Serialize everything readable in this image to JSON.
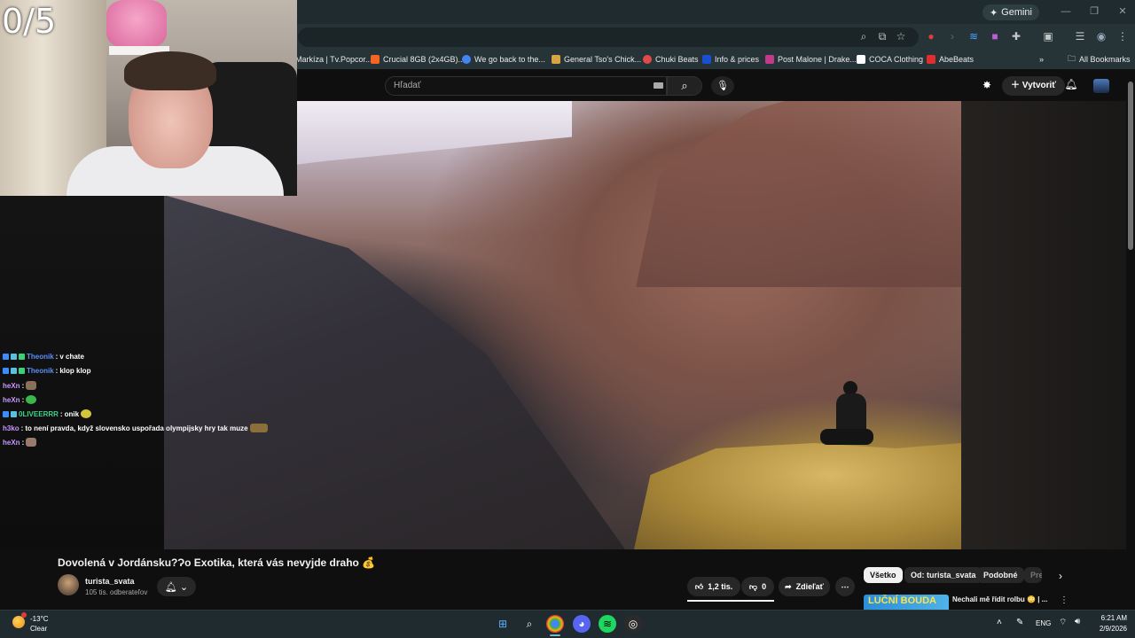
{
  "browser": {
    "gemini_label": "Gemini",
    "bookmarks": [
      {
        "label": "Markíza | Tv.Popcor...",
        "color": "#e8eaed"
      },
      {
        "label": "Crucial 8GB (2x4GB)...",
        "color": "#f26522"
      },
      {
        "label": "We go back to the...",
        "color": "#4285f4"
      },
      {
        "label": "General Tso's Chick...",
        "color": "#d9a441"
      },
      {
        "label": "Chuki Beats",
        "color": "#e24a4a"
      },
      {
        "label": "Info & prices",
        "color": "#1a4fd1"
      },
      {
        "label": "Post Malone | Drake...",
        "color": "#c23a8a"
      },
      {
        "label": "COCA Clothing",
        "color": "#111111"
      },
      {
        "label": "AbeBeats",
        "color": "#e02d2d"
      }
    ],
    "all_bookmarks_label": "All Bookmarks"
  },
  "youtube": {
    "search_placeholder": "Hľadať",
    "create_label": "Vytvoriť",
    "video_title": "Dovolená v Jordánsku?Ɂo Exotika, která vás nevyjde draho 💰",
    "channel_name": "turista_svata",
    "subscribers": "105 tis. odberateľov",
    "likes": "1,2 tis.",
    "dislikes": "0",
    "share_label": "Zdieľať",
    "chips": [
      "Všetko",
      "Od: turista_svata",
      "Podobné",
      "Pre"
    ],
    "recommended_thumb_text": "LUČNÍ BOUDA",
    "recommended_title": "Nechali mě řídit rolbu 😳 | ..."
  },
  "stream": {
    "counter": "0/5",
    "chat": [
      {
        "user": "Theonik",
        "user_color": "#5b8ff9",
        "message": "v chate",
        "badges": [
          "#3d8bff",
          "#5bc0de",
          "#3bd17a"
        ]
      },
      {
        "user": "Theonik",
        "user_color": "#5b8ff9",
        "message": "klop klop",
        "badges": [
          "#3d8bff",
          "#5bc0de",
          "#3bd17a"
        ]
      },
      {
        "user": "heXn",
        "user_color": "#c996ff",
        "message": "",
        "emote": "#8a6f5a",
        "badges": []
      },
      {
        "user": "heXn",
        "user_color": "#c996ff",
        "message": "",
        "emote": "#3bb64a",
        "badges": []
      },
      {
        "user": "0LIVEERRR",
        "user_color": "#3fd08c",
        "message": "onik",
        "emote": "#d4c43a",
        "badges": [
          "#3d8bff",
          "#5bc0de"
        ]
      },
      {
        "user": "h3ko",
        "user_color": "#c996ff",
        "message": "to není pravda, když slovensko uspořada olympijsky hry tak muze",
        "emote": "#8a6f3a",
        "badges": []
      },
      {
        "user": "heXn",
        "user_color": "#c996ff",
        "message": "",
        "emote": "#9a7a6a",
        "badges": []
      }
    ]
  },
  "taskbar": {
    "temperature": "-13°C",
    "condition": "Clear",
    "language": "ENG",
    "time": "6:21 AM",
    "date": "2/9/2026"
  }
}
